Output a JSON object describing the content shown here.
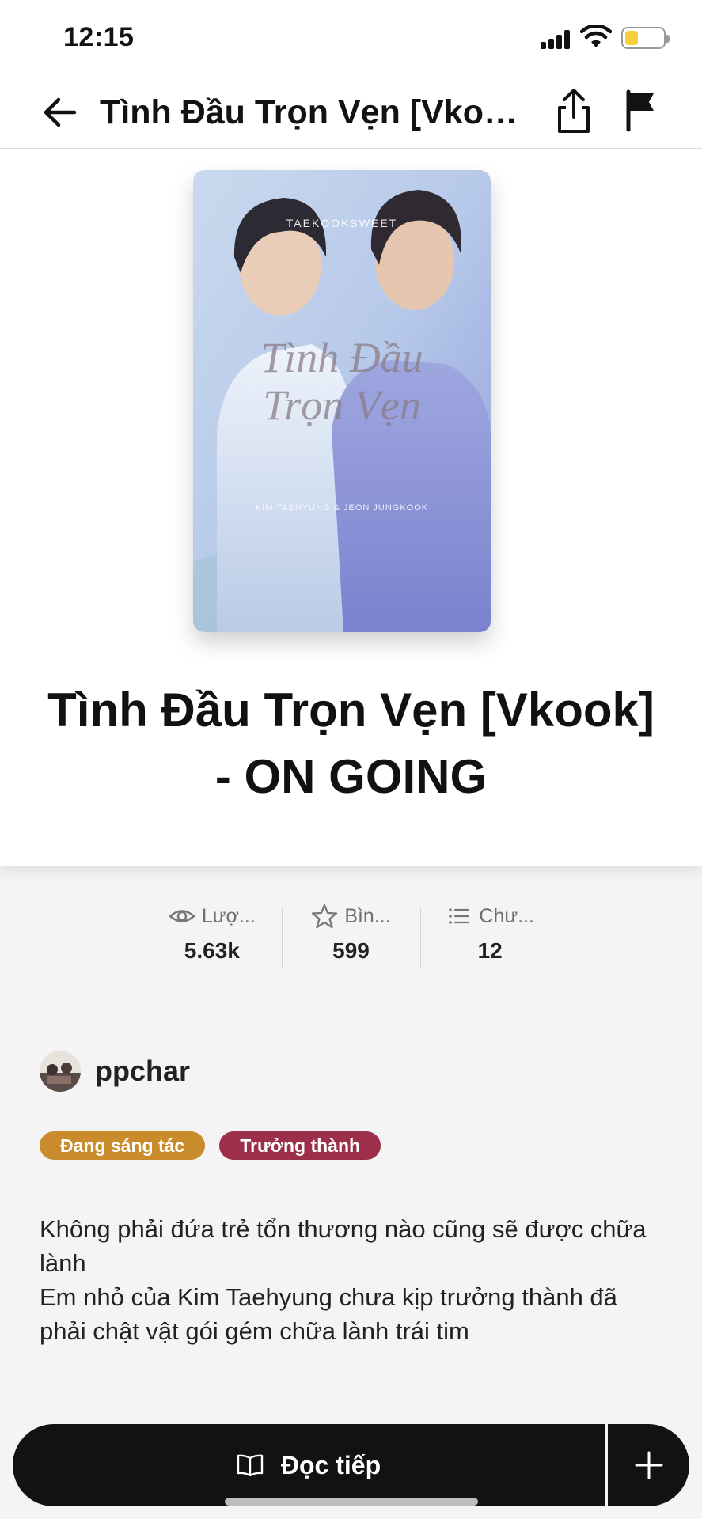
{
  "status_bar": {
    "time": "12:15"
  },
  "nav": {
    "title": "Tình Đầu Trọn Vẹn [Vkoo..."
  },
  "cover": {
    "brand": "TAEKOOKSWEET",
    "title_line1": "Tình Đầu",
    "title_line2": "Trọn Vẹn",
    "subtitle": "KIM TAEHYUNG & JEON JUNGKOOK"
  },
  "book": {
    "title": "Tình Đầu Trọn Vẹn [Vkook] - ON GOING"
  },
  "stats": [
    {
      "label": "Lượ...",
      "value": "5.63k",
      "icon": "eye-icon"
    },
    {
      "label": "Bìn...",
      "value": "599",
      "icon": "star-icon"
    },
    {
      "label": "Chư...",
      "value": "12",
      "icon": "list-icon"
    }
  ],
  "author": {
    "name": "ppchar"
  },
  "tags": [
    {
      "label": "Đang sáng tác",
      "color": "#c98b2b"
    },
    {
      "label": "Trưởng thành",
      "color": "#9c2f4a"
    }
  ],
  "description": "Không phải đứa trẻ tổn thương nào cũng sẽ được chữa lành\nEm nhỏ của Kim Taehyung chưa kịp trưởng thành đã phải chật vật gói gém chữa lành trái tim",
  "actions": {
    "read_label": "Đọc tiếp"
  }
}
